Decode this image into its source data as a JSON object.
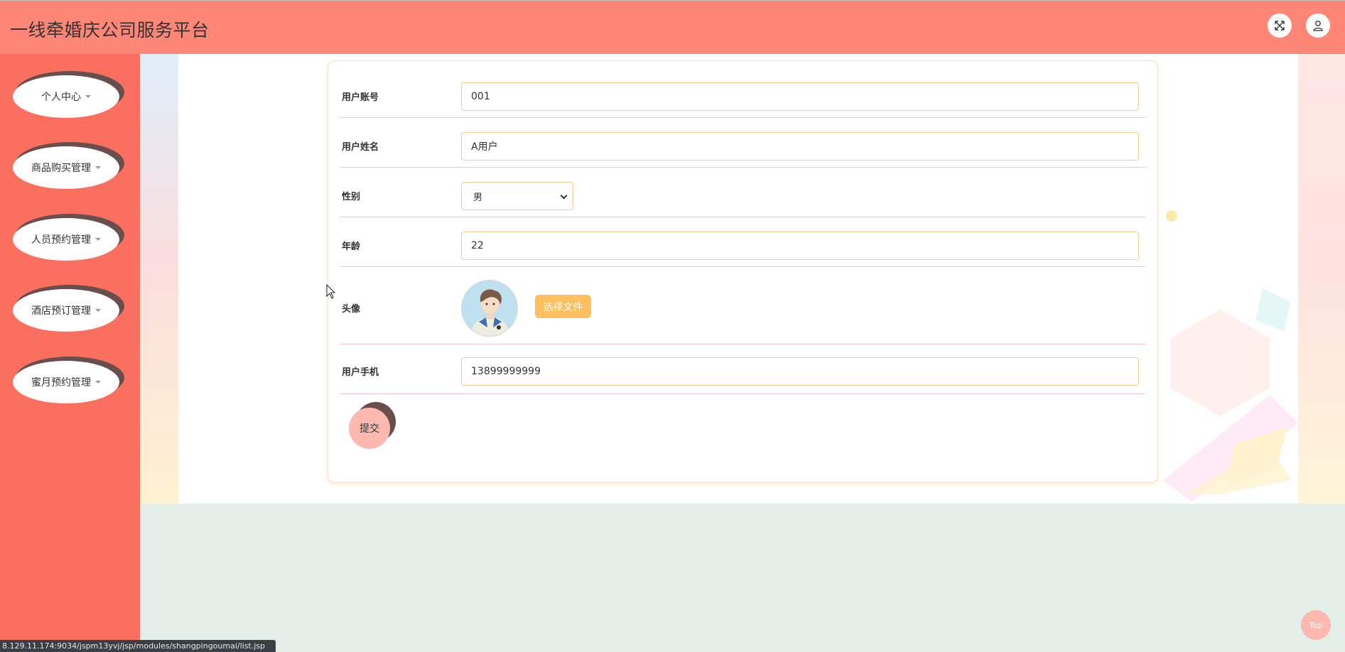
{
  "header": {
    "title": "一线牵婚庆公司服务平台",
    "fullscreen_icon": "fullscreen-icon",
    "user_icon": "user-icon"
  },
  "sidebar": {
    "items": [
      {
        "label": "个人中心"
      },
      {
        "label": "商品购买管理"
      },
      {
        "label": "人员预约管理"
      },
      {
        "label": "酒店预订管理"
      },
      {
        "label": "蜜月预约管理"
      }
    ]
  },
  "form": {
    "account_label": "用户账号",
    "account_value": "001",
    "name_label": "用户姓名",
    "name_value": "A用户",
    "gender_label": "性别",
    "gender_value": "男",
    "age_label": "年龄",
    "age_value": "22",
    "avatar_label": "头像",
    "choose_file_label": "选择文件",
    "phone_label": "用户手机",
    "phone_value": "13899999999",
    "submit_label": "提交"
  },
  "statusbar": {
    "url": "8.129.11.174:9034/jspm13yvj/jsp/modules/shangpingoumai/list.jsp"
  },
  "top_button": {
    "label": "Top"
  },
  "colors": {
    "header_bg": "#fd8677",
    "sidebar_bg": "#fb6f5f",
    "accent_orange": "#ffbf5e",
    "submit_pink": "#fdb9b0"
  }
}
